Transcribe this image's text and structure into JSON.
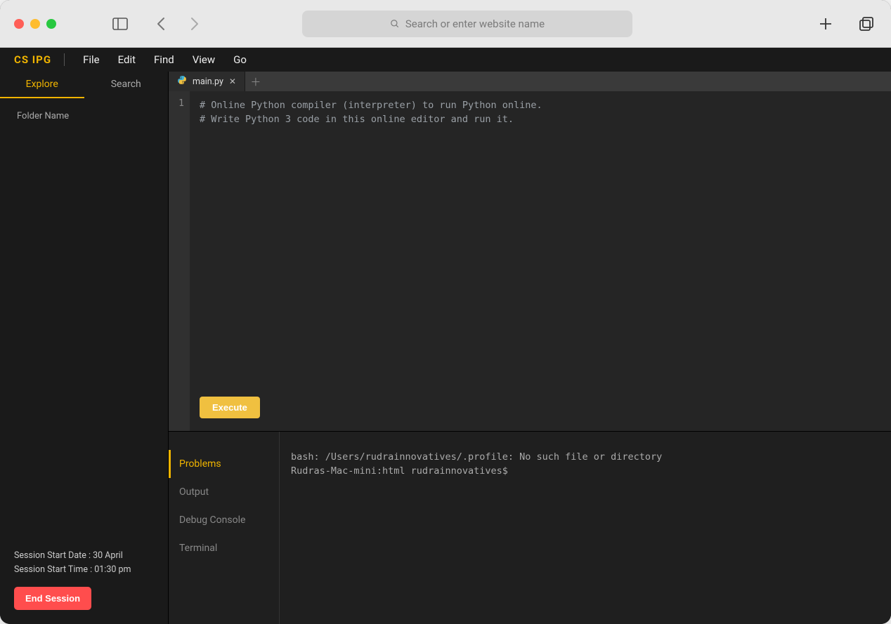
{
  "browser": {
    "address_placeholder": "Search or enter website name"
  },
  "app": {
    "logo": "CS IPG",
    "menus": [
      "File",
      "Edit",
      "Find",
      "View",
      "Go"
    ]
  },
  "sidebar": {
    "tabs": [
      "Explore",
      "Search"
    ],
    "active_tab_index": 0,
    "folder_label": "Folder Name",
    "session_date_label": "Session Start Date : 30 April",
    "session_time_label": "Session Start Time : 01:30 pm",
    "end_session_label": "End Session"
  },
  "editor": {
    "tabs": [
      {
        "name": "main.py",
        "icon": "python"
      }
    ],
    "gutter": [
      "1"
    ],
    "code_text": "# Online Python compiler (interpreter) to run Python online.\n# Write Python 3 code in this online editor and run it.",
    "execute_label": "Execute"
  },
  "bottom_panel": {
    "tabs": [
      "Problems",
      "Output",
      "Debug Console",
      "Terminal"
    ],
    "active_tab_index": 0,
    "output_text": "bash: /Users/rudrainnovatives/.profile: No such file or directory\nRudras-Mac-mini:html rudrainnovatives$"
  }
}
